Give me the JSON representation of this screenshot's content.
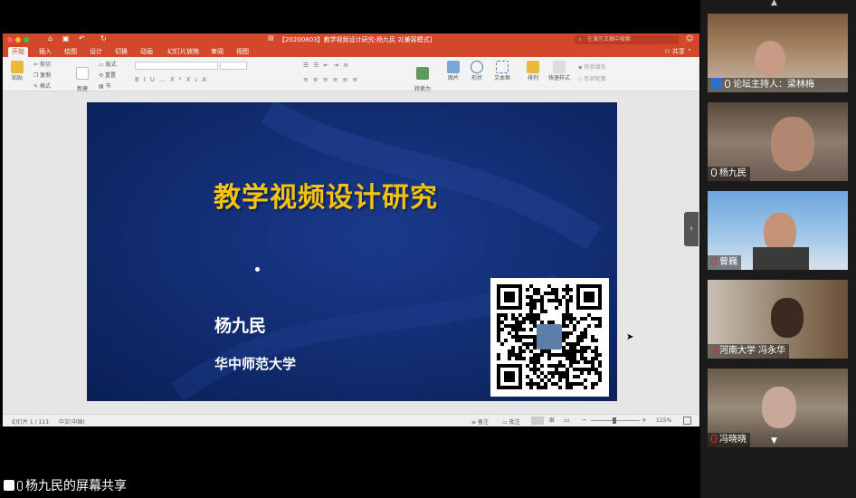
{
  "ppt": {
    "doc_title": "【20200803】教学视频设计研究-杨九民 2[兼容模式]",
    "search_placeholder": "在演示文稿中搜索",
    "tabs": [
      "开始",
      "插入",
      "绘图",
      "设计",
      "切换",
      "动画",
      "幻灯片放映",
      "审阅",
      "视图"
    ],
    "share": "共享",
    "ribbon": {
      "paste": "粘贴",
      "cut": "剪切",
      "copy": "复制",
      "format": "格式",
      "new_slide": "新建\n幻灯片",
      "layout": "版式",
      "reset": "重置",
      "section": "节",
      "convert_smartart": "转换为\nSmartArt",
      "picture": "图片",
      "shape": "形状",
      "textbox": "文本框",
      "arrange": "排列",
      "quick_styles": "快速样式",
      "shape_fill": "形状填充",
      "shape_outline": "形状轮廓"
    },
    "slide": {
      "title": "教学视频设计研究",
      "author": "杨九民",
      "institution": "华中师范大学"
    },
    "status": {
      "slide_counter": "幻灯片 1 / 111",
      "language": "中文(中国)",
      "notes": "备注",
      "comments": "批注",
      "zoom": "115%"
    }
  },
  "participants": [
    {
      "label": "论坛主持人：梁林梅",
      "muted": false,
      "host": true
    },
    {
      "label": "杨九民",
      "muted": false,
      "host": false
    },
    {
      "label": "曾巍",
      "muted": true,
      "host": false
    },
    {
      "label": "河南大学 冯永华",
      "muted": true,
      "host": false
    },
    {
      "label": "冯晓晓",
      "muted": true,
      "host": false
    }
  ],
  "share_banner": "杨九民的屏幕共享",
  "colors": {
    "accent": "#d3472b",
    "slide_title": "#f5c20e",
    "slide_bg": "#102a6c"
  }
}
